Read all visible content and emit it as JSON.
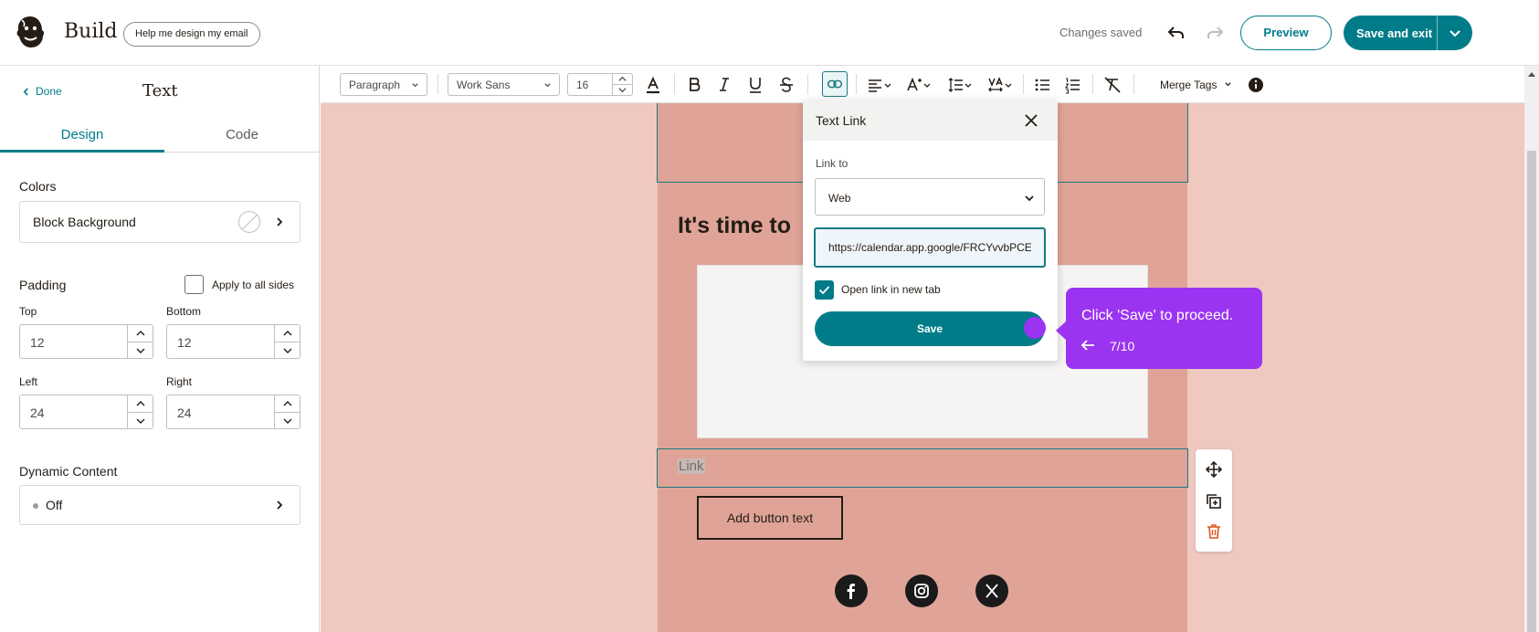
{
  "header": {
    "app_title": "Build",
    "help_button": "Help me design my email",
    "status": "Changes saved",
    "preview_label": "Preview",
    "save_exit_label": "Save and exit",
    "accent_color": "#007c89"
  },
  "left_panel": {
    "back_label": "Done",
    "title": "Text",
    "tabs": [
      {
        "label": "Design",
        "active": true
      },
      {
        "label": "Code",
        "active": false
      }
    ],
    "colors": {
      "heading": "Colors",
      "item_label": "Block Background"
    },
    "padding": {
      "heading": "Padding",
      "apply_all_label": "Apply to all sides",
      "apply_all_checked": false,
      "fields": [
        {
          "label": "Top",
          "value": "12"
        },
        {
          "label": "Bottom",
          "value": "12"
        },
        {
          "label": "Left",
          "value": "24"
        },
        {
          "label": "Right",
          "value": "24"
        }
      ]
    },
    "dynamic_content": {
      "heading": "Dynamic Content",
      "value": "Off"
    }
  },
  "toolbar": {
    "block_type": "Paragraph",
    "font_family": "Work Sans",
    "font_size": "16",
    "merge_tags": "Merge Tags"
  },
  "email": {
    "heading": "It's time to",
    "link_text": "Link",
    "button_text": "Add button text",
    "background_color": "#dfa497",
    "canvas_color": "#efc8c0"
  },
  "link_popover": {
    "title": "Text Link",
    "link_to_label": "Link to",
    "link_to_value": "Web",
    "url": "https://calendar.app.google/FRCYvvbPCE",
    "open_new_tab_label": "Open link in new tab",
    "open_new_tab_checked": true,
    "save_label": "Save"
  },
  "tour": {
    "message": "Click 'Save' to proceed.",
    "step": "7/10",
    "color": "#9b34f0"
  }
}
